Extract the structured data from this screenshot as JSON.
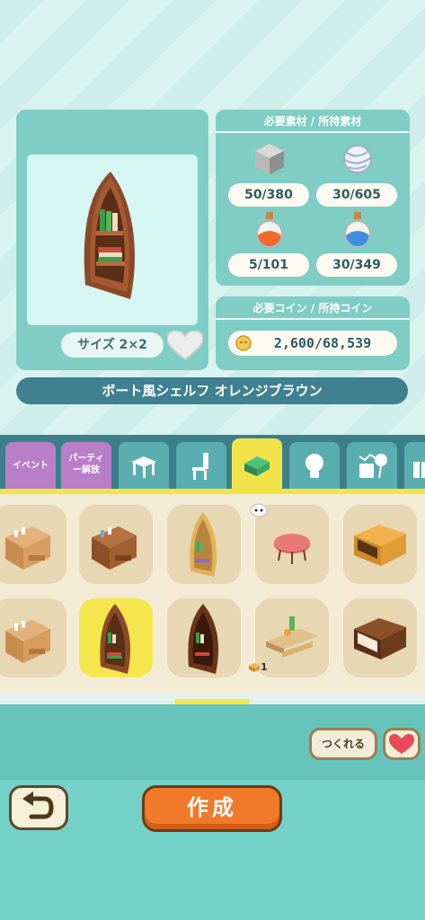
{
  "preview": {
    "size_label": "サイズ 2×2",
    "item_name": "ボート風シェルフ オレンジブラウン"
  },
  "materials": {
    "header": "必要素材 / 所持素材",
    "items": [
      {
        "icon": "stone-cube-icon",
        "count": "50/380"
      },
      {
        "icon": "yarn-ball-icon",
        "count": "30/605"
      },
      {
        "icon": "orange-potion-icon",
        "count": "5/101"
      },
      {
        "icon": "blue-potion-icon",
        "count": "30/349"
      }
    ]
  },
  "coins": {
    "header": "必要コイン / 所持コイン",
    "value": "2,600/68,539"
  },
  "tabs": [
    {
      "label": "イベント",
      "kind": "purple"
    },
    {
      "label": "パーティー解放",
      "kind": "purple"
    },
    {
      "icon": "table-icon"
    },
    {
      "icon": "chair-icon"
    },
    {
      "icon": "green-box-icon",
      "active": true
    },
    {
      "icon": "lightbulb-icon"
    },
    {
      "icon": "cup-balloon-icon"
    },
    {
      "icon": "gift-icon"
    }
  ],
  "grid": {
    "owned_badge": "1"
  },
  "buttons": {
    "filter_label": "つくれる",
    "create_label": "作成"
  },
  "colors": {
    "panel": "#7fcdc4",
    "tab_active": "#f3e34b",
    "create": "#f07a2a",
    "name_bar": "#3f8190"
  }
}
